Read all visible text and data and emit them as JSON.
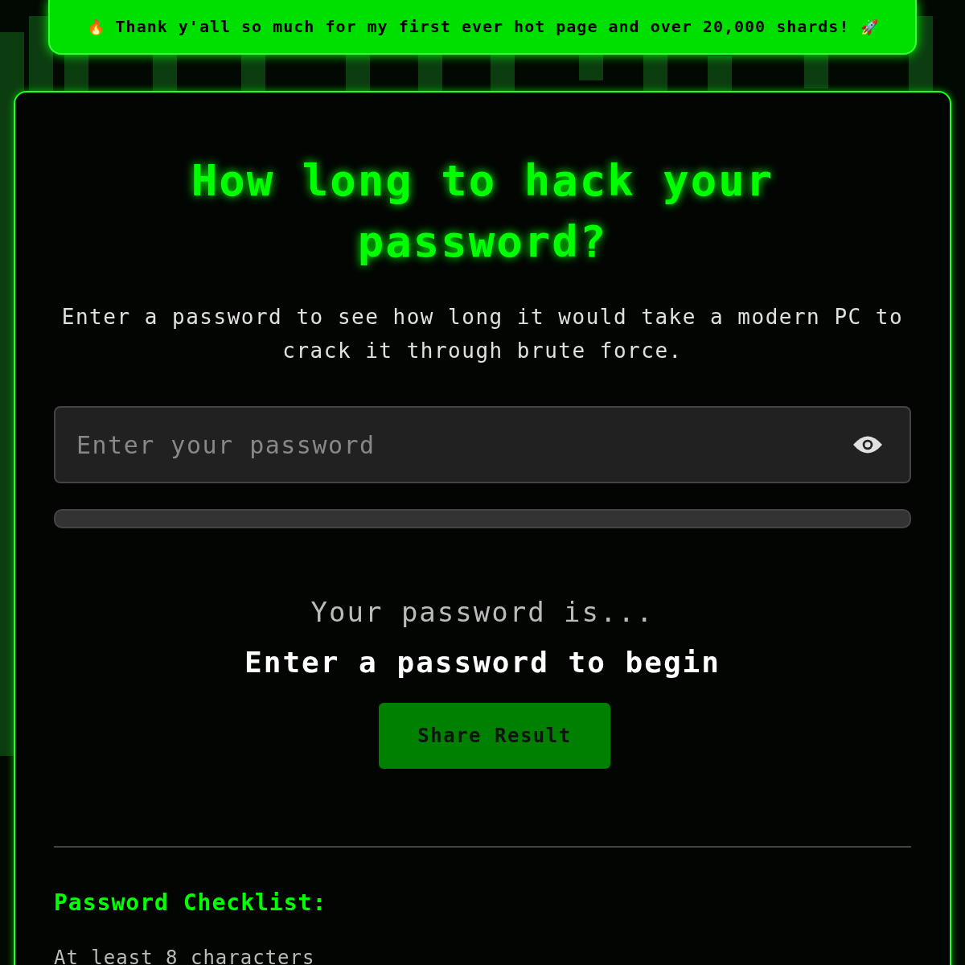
{
  "banner": {
    "icon_left": "🔥",
    "text": "Thank y'all so much for my first ever hot page and over 20,000 shards!",
    "icon_right": "🚀"
  },
  "title": "How long to hack your password?",
  "subtitle": "Enter a password to see how long it would take a modern PC to crack it through brute force.",
  "password_field": {
    "placeholder": "Enter your password",
    "masked": true
  },
  "strength_meter": {
    "level": 0
  },
  "result": {
    "label": "Your password is...",
    "value": "Enter a password to begin"
  },
  "share_button": "Share Result",
  "checklist": {
    "title": "Password Checklist:",
    "items": [
      {
        "label": "At least 8 characters",
        "met": false
      }
    ]
  }
}
